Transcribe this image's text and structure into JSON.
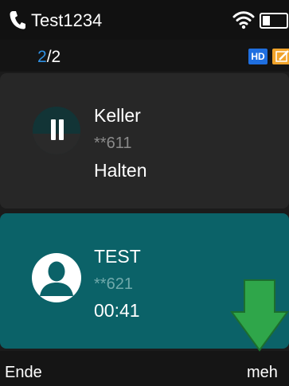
{
  "status_bar": {
    "account_name": "Test1234",
    "icons": [
      "phone-icon",
      "wifi-icon",
      "battery-icon"
    ]
  },
  "call_counter": {
    "current": "2",
    "separator": "/",
    "total": "2"
  },
  "badges": {
    "hd_label": "HD",
    "edit_icon": "edit-icon"
  },
  "calls": [
    {
      "name": "Keller",
      "number": "**611",
      "status": "Halten",
      "icon": "pause-icon"
    },
    {
      "name": "TEST",
      "number": "**621",
      "status": "00:41",
      "icon": "contact-avatar-icon"
    }
  ],
  "softkeys": {
    "left": "Ende",
    "right": "meh"
  },
  "colors": {
    "active_card": "#0b6268",
    "held_card": "#272727",
    "counter_accent": "#2f8fe0",
    "arrow": "#2fa64a"
  }
}
